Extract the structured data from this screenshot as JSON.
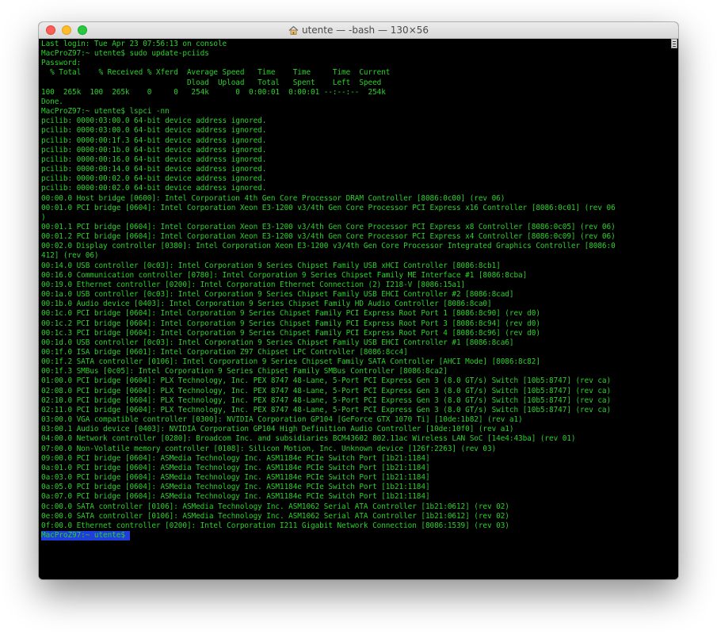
{
  "window": {
    "title": "utente — -bash — 130×56"
  },
  "terminal": {
    "lines": [
      "Last login: Tue Apr 23 07:56:13 on console",
      "MacProZ97:~ utente$ sudo update-pciids",
      "Password:",
      "  % Total    % Received % Xferd  Average Speed   Time    Time     Time  Current",
      "                                 Dload  Upload   Total   Spent    Left  Speed",
      "100  265k  100  265k    0     0   254k      0  0:00:01  0:00:01 --:--:--  254k",
      "Done.",
      "MacProZ97:~ utente$ lspci -nn",
      "pcilib: 0000:03:00.0 64-bit device address ignored.",
      "pcilib: 0000:03:00.0 64-bit device address ignored.",
      "pcilib: 0000:00:1f.3 64-bit device address ignored.",
      "pcilib: 0000:00:1b.0 64-bit device address ignored.",
      "pcilib: 0000:00:16.0 64-bit device address ignored.",
      "pcilib: 0000:00:14.0 64-bit device address ignored.",
      "pcilib: 0000:00:02.0 64-bit device address ignored.",
      "pcilib: 0000:00:02.0 64-bit device address ignored.",
      "00:00.0 Host bridge [0600]: Intel Corporation 4th Gen Core Processor DRAM Controller [8086:0c00] (rev 06)",
      "00:01.0 PCI bridge [0604]: Intel Corporation Xeon E3-1200 v3/4th Gen Core Processor PCI Express x16 Controller [8086:0c01] (rev 06",
      ")",
      "00:01.1 PCI bridge [0604]: Intel Corporation Xeon E3-1200 v3/4th Gen Core Processor PCI Express x8 Controller [8086:0c05] (rev 06)",
      "00:01.2 PCI bridge [0604]: Intel Corporation Xeon E3-1200 v3/4th Gen Core Processor PCI Express x4 Controller [8086:0c09] (rev 06)",
      "00:02.0 Display controller [0380]: Intel Corporation Xeon E3-1200 v3/4th Gen Core Processor Integrated Graphics Controller [8086:0",
      "412] (rev 06)",
      "00:14.0 USB controller [0c03]: Intel Corporation 9 Series Chipset Family USB xHCI Controller [8086:8cb1]",
      "00:16.0 Communication controller [0780]: Intel Corporation 9 Series Chipset Family ME Interface #1 [8086:8cba]",
      "00:19.0 Ethernet controller [0200]: Intel Corporation Ethernet Connection (2) I218-V [8086:15a1]",
      "00:1a.0 USB controller [0c03]: Intel Corporation 9 Series Chipset Family USB EHCI Controller #2 [8086:8cad]",
      "00:1b.0 Audio device [0403]: Intel Corporation 9 Series Chipset Family HD Audio Controller [8086:8ca0]",
      "00:1c.0 PCI bridge [0604]: Intel Corporation 9 Series Chipset Family PCI Express Root Port 1 [8086:8c90] (rev d0)",
      "00:1c.2 PCI bridge [0604]: Intel Corporation 9 Series Chipset Family PCI Express Root Port 3 [8086:8c94] (rev d0)",
      "00:1c.3 PCI bridge [0604]: Intel Corporation 9 Series Chipset Family PCI Express Root Port 4 [8086:8c96] (rev d0)",
      "00:1d.0 USB controller [0c03]: Intel Corporation 9 Series Chipset Family USB EHCI Controller #1 [8086:8ca6]",
      "00:1f.0 ISA bridge [0601]: Intel Corporation Z97 Chipset LPC Controller [8086:8cc4]",
      "00:1f.2 SATA controller [0106]: Intel Corporation 9 Series Chipset Family SATA Controller [AHCI Mode] [8086:8c82]",
      "00:1f.3 SMBus [0c05]: Intel Corporation 9 Series Chipset Family SMBus Controller [8086:8ca2]",
      "01:00.0 PCI bridge [0604]: PLX Technology, Inc. PEX 8747 48-Lane, 5-Port PCI Express Gen 3 (8.0 GT/s) Switch [10b5:8747] (rev ca)",
      "02:08.0 PCI bridge [0604]: PLX Technology, Inc. PEX 8747 48-Lane, 5-Port PCI Express Gen 3 (8.0 GT/s) Switch [10b5:8747] (rev ca)",
      "02:10.0 PCI bridge [0604]: PLX Technology, Inc. PEX 8747 48-Lane, 5-Port PCI Express Gen 3 (8.0 GT/s) Switch [10b5:8747] (rev ca)",
      "02:11.0 PCI bridge [0604]: PLX Technology, Inc. PEX 8747 48-Lane, 5-Port PCI Express Gen 3 (8.0 GT/s) Switch [10b5:8747] (rev ca)",
      "03:00.0 VGA compatible controller [0300]: NVIDIA Corporation GP104 [GeForce GTX 1070 Ti] [10de:1b82] (rev a1)",
      "03:00.1 Audio device [0403]: NVIDIA Corporation GP104 High Definition Audio Controller [10de:10f0] (rev a1)",
      "04:00.0 Network controller [0280]: Broadcom Inc. and subsidiaries BCM43602 802.11ac Wireless LAN SoC [14e4:43ba] (rev 01)",
      "07:00.0 Non-Volatile memory controller [0108]: Silicon Motion, Inc. Unknown device [126f:2263] (rev 03)",
      "09:00.0 PCI bridge [0604]: ASMedia Technology Inc. ASM1184e PCIe Switch Port [1b21:1184]",
      "0a:01.0 PCI bridge [0604]: ASMedia Technology Inc. ASM1184e PCIe Switch Port [1b21:1184]",
      "0a:03.0 PCI bridge [0604]: ASMedia Technology Inc. ASM1184e PCIe Switch Port [1b21:1184]",
      "0a:05.0 PCI bridge [0604]: ASMedia Technology Inc. ASM1184e PCIe Switch Port [1b21:1184]",
      "0a:07.0 PCI bridge [0604]: ASMedia Technology Inc. ASM1184e PCIe Switch Port [1b21:1184]",
      "0c:00.0 SATA controller [0106]: ASMedia Technology Inc. ASM1062 Serial ATA Controller [1b21:0612] (rev 02)",
      "0e:00.0 SATA controller [0106]: ASMedia Technology Inc. ASM1062 Serial ATA Controller [1b21:0612] (rev 02)",
      "0f:00.0 Ethernet controller [0200]: Intel Corporation I211 Gigabit Network Connection [8086:1539] (rev 03)",
      "MacProZ97:~ utente$ "
    ],
    "selected_line_index": 51,
    "colors": {
      "text": "#2bd12b",
      "background": "#000000",
      "selection": "#1f3fd8"
    }
  }
}
